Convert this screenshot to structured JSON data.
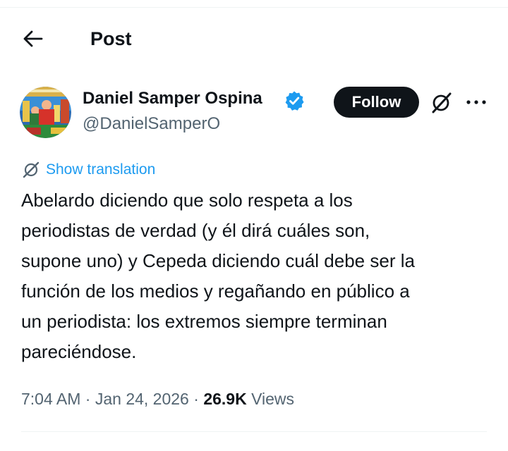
{
  "header": {
    "back_icon": "arrow-left-icon",
    "title": "Post"
  },
  "author": {
    "name": "Daniel Samper Ospina",
    "handle": "@DanielSamperO",
    "verified": true,
    "verified_color": "#1d9bf0"
  },
  "actions": {
    "follow_label": "Follow",
    "grok_icon": "grok-icon",
    "more_icon": "more-horizontal-icon"
  },
  "translation": {
    "label": "Show translation",
    "icon": "translate-icon"
  },
  "post": {
    "text": "Abelardo diciendo que solo respeta a los\nperiodistas de verdad (y él dirá cuáles son,\nsupone uno) y Cepeda diciendo cuál debe ser la\nfunción de los medios y regañando en público a\nun periodista: los extremos siempre terminan\npareciéndose."
  },
  "meta": {
    "time": "7:04 AM",
    "separator": " · ",
    "date": "Jan 24, 2026",
    "views_count": "26.9K",
    "views_label": " Views"
  },
  "colors": {
    "accent": "#1d9bf0",
    "text_primary": "#0f1419",
    "text_secondary": "#536471",
    "follow_bg": "#0f1419"
  }
}
